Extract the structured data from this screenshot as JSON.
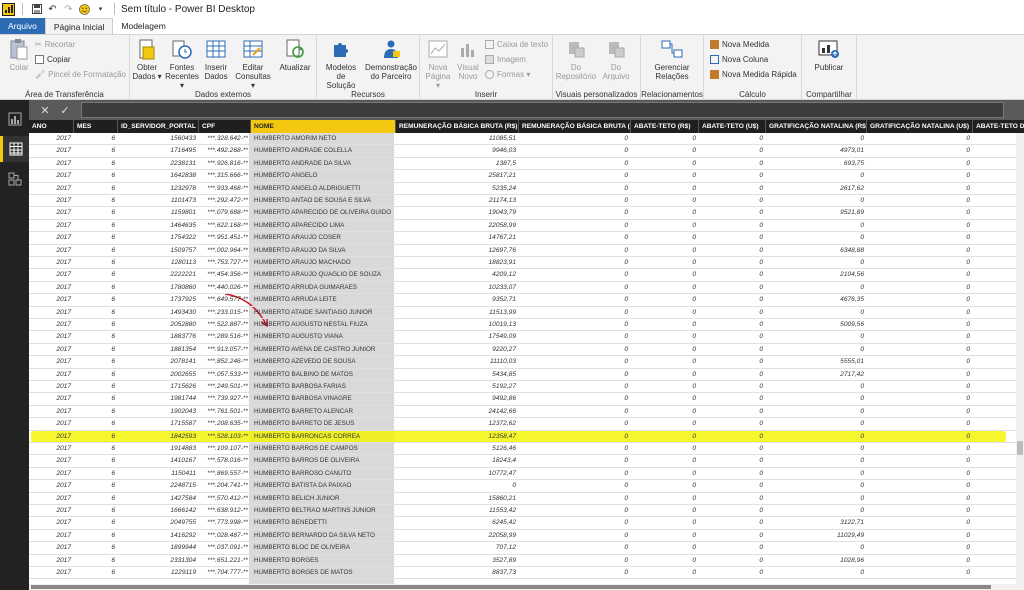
{
  "title": "Sem título - Power BI Desktop",
  "tabs": [
    "Arquivo",
    "Página Inicial",
    "Modelagem"
  ],
  "ribbon": {
    "clipboard": {
      "paste": "Colar",
      "cut": "Recortar",
      "copy": "Copiar",
      "format_painter": "Pincel de Formatação",
      "label": "Área de Transferência"
    },
    "external": {
      "get_data": "Obter Dados ▾",
      "recent": "Fontes Recentes ▾",
      "enter_data": "Inserir Dados",
      "edit": "Editar Consultas ▾",
      "refresh": "Atualizar",
      "label": "Dados externos"
    },
    "resources": {
      "models": "Modelos de Solução",
      "demo": "Demonstração do Parceiro",
      "label": "Recursos"
    },
    "insert": {
      "new_page": "Nova Página ▾",
      "new_visual": "Visual Novo",
      "textbox": "Caixa de texto",
      "image": "Imagem",
      "shapes": "Formas ▾",
      "label": "Inserir"
    },
    "custom_visuals": {
      "from_repo": "Do Repositório",
      "from_file": "Do Arquivo",
      "label": "Visuais personalizados"
    },
    "relationships": {
      "manage": "Gerenciar Relações",
      "label": "Relacionamentos"
    },
    "calc": {
      "new_measure": "Nova Medida",
      "new_column": "Nova Coluna",
      "quick_measure": "Nova Medida Rápida",
      "label": "Cálculo"
    },
    "share": {
      "publish": "Publicar",
      "label": "Compartilhar"
    }
  },
  "columns": [
    "ANO",
    "MES",
    "ID_SERVIDOR_PORTAL",
    "CPF",
    "NOME",
    "REMUNERAÇÃO BÁSICA BRUTA (R$)",
    "REMUNERAÇÃO BÁSICA BRUTA (U$)",
    "ABATE-TETO (R$)",
    "ABATE-TETO (U$)",
    "GRATIFICAÇÃO NATALINA (R$)",
    "GRATIFICAÇÃO NATALINA (U$)",
    "ABATE-TETO DA G"
  ],
  "rows": [
    [
      "2017",
      "6",
      "1560433",
      "***.328.642-**",
      "HUMBERTO AMORIM NETO",
      "11085,51",
      "0",
      "0",
      "0",
      "0",
      "0"
    ],
    [
      "2017",
      "6",
      "1716495",
      "***.492.268-**",
      "HUMBERTO ANDRADE COLELLA",
      "9946,03",
      "0",
      "0",
      "0",
      "4973,01",
      "0"
    ],
    [
      "2017",
      "6",
      "2238131",
      "***.926.816-**",
      "HUMBERTO ANDRADE DA SILVA",
      "1387,5",
      "0",
      "0",
      "0",
      "693,75",
      "0"
    ],
    [
      "2017",
      "6",
      "1642838",
      "***.315.666-**",
      "HUMBERTO ANGELO",
      "25817,21",
      "0",
      "0",
      "0",
      "0",
      "0"
    ],
    [
      "2017",
      "6",
      "1232978",
      "***.933.468-**",
      "HUMBERTO ANGELO ALDRIGUETTI",
      "5235,24",
      "0",
      "0",
      "0",
      "2617,62",
      "0"
    ],
    [
      "2017",
      "6",
      "1101473",
      "***.292.472-**",
      "HUMBERTO ANTAO DE SOUSA E SILVA",
      "21174,13",
      "0",
      "0",
      "0",
      "0",
      "0"
    ],
    [
      "2017",
      "6",
      "1159801",
      "***.079.688-**",
      "HUMBERTO APARECIDO DE OLIVEIRA GUIDO",
      "19043,79",
      "0",
      "0",
      "0",
      "9521,89",
      "0"
    ],
    [
      "2017",
      "6",
      "1464635",
      "***.622.168-**",
      "HUMBERTO APARECIDO LIMA",
      "22058,99",
      "0",
      "0",
      "0",
      "0",
      "0"
    ],
    [
      "2017",
      "6",
      "1754322",
      "***.951.451-**",
      "HUMBERTO ARAUJO COSER",
      "14767,21",
      "0",
      "0",
      "0",
      "0",
      "0"
    ],
    [
      "2017",
      "6",
      "1509757",
      "***.002.964-**",
      "HUMBERTO ARAUJO DA SILVA",
      "12697,76",
      "0",
      "0",
      "0",
      "6348,88",
      "0"
    ],
    [
      "2017",
      "6",
      "1280113",
      "***.753.727-**",
      "HUMBERTO ARAUJO MACHADO",
      "18823,91",
      "0",
      "0",
      "0",
      "0",
      "0"
    ],
    [
      "2017",
      "6",
      "2222221",
      "***.454.356-**",
      "HUMBERTO ARAUJO QUAGLIO DE SOUZA",
      "4209,12",
      "0",
      "0",
      "0",
      "2104,56",
      "0"
    ],
    [
      "2017",
      "6",
      "1780860",
      "***.440.026-**",
      "HUMBERTO ARRUDA GUIMARAES",
      "10233,07",
      "0",
      "0",
      "0",
      "0",
      "0"
    ],
    [
      "2017",
      "6",
      "1737925",
      "***.649.577-**",
      "HUMBERTO ARRUDA LEITE",
      "9352,71",
      "0",
      "0",
      "0",
      "4676,35",
      "0"
    ],
    [
      "2017",
      "6",
      "1493430",
      "***.233.015-**",
      "HUMBERTO ATAIDE SANTIAGO JUNIOR",
      "11513,99",
      "0",
      "0",
      "0",
      "0",
      "0"
    ],
    [
      "2017",
      "6",
      "2052880",
      "***.522.887-**",
      "HUMBERTO AUGUSTO NESTAL FIUZA",
      "10019,13",
      "0",
      "0",
      "0",
      "5009,56",
      "0"
    ],
    [
      "2017",
      "6",
      "1883776",
      "***.289.516-**",
      "HUMBERTO AUGUSTO VIANA",
      "17549,09",
      "0",
      "0",
      "0",
      "0",
      "0"
    ],
    [
      "2017",
      "6",
      "1881354",
      "***.913.057-**",
      "HUMBERTO AVENA DE CASTRO JUNIOR",
      "9220,27",
      "0",
      "0",
      "0",
      "0",
      "0"
    ],
    [
      "2017",
      "6",
      "2078141",
      "***.852.246-**",
      "HUMBERTO AZEVEDO DE SOUSA",
      "11110,03",
      "0",
      "0",
      "0",
      "5555,01",
      "0"
    ],
    [
      "2017",
      "6",
      "2002655",
      "***.057.533-**",
      "HUMBERTO BALBINO DE MATOS",
      "5434,85",
      "0",
      "0",
      "0",
      "2717,42",
      "0"
    ],
    [
      "2017",
      "6",
      "1715626",
      "***.249.501-**",
      "HUMBERTO BARBOSA FARIAS",
      "5192,27",
      "0",
      "0",
      "0",
      "0",
      "0"
    ],
    [
      "2017",
      "6",
      "1981744",
      "***.739.927-**",
      "HUMBERTO BARBOSA VINAGRE",
      "9492,86",
      "0",
      "0",
      "0",
      "0",
      "0"
    ],
    [
      "2017",
      "6",
      "1902043",
      "***.761.501-**",
      "HUMBERTO BARRETO ALENCAR",
      "24142,66",
      "0",
      "0",
      "0",
      "0",
      "0"
    ],
    [
      "2017",
      "6",
      "1715587",
      "***.208.635-**",
      "HUMBERTO BARRETO DE JESUS",
      "12372,62",
      "0",
      "0",
      "0",
      "0",
      "0"
    ],
    [
      "2017",
      "6",
      "1842593",
      "***.528.103-**",
      "HUMBERTO BARRONCAS CORREA",
      "12358,47",
      "0",
      "0",
      "0",
      "0",
      "0"
    ],
    [
      "2017",
      "6",
      "1914883",
      "***.109.107-**",
      "HUMBERTO BARROS DE CAMPOS",
      "5126,46",
      "0",
      "0",
      "0",
      "0",
      "0"
    ],
    [
      "2017",
      "6",
      "1410167",
      "***.578.016-**",
      "HUMBERTO BARROS DE OLIVEIRA",
      "18243,4",
      "0",
      "0",
      "0",
      "0",
      "0"
    ],
    [
      "2017",
      "6",
      "1150411",
      "***.869.557-**",
      "HUMBERTO BARROSO CANUTO",
      "10772,47",
      "0",
      "0",
      "0",
      "0",
      "0"
    ],
    [
      "2017",
      "6",
      "2248715",
      "***.204.741-**",
      "HUMBERTO BATISTA DA PAIXAO",
      "0",
      "0",
      "0",
      "0",
      "0",
      "0"
    ],
    [
      "2017",
      "6",
      "1427584",
      "***.570.412-**",
      "HUMBERTO BELICH JUNIOR",
      "15860,21",
      "0",
      "0",
      "0",
      "0",
      "0"
    ],
    [
      "2017",
      "6",
      "1666142",
      "***.638.912-**",
      "HUMBERTO BELTRAO MARTINS JUNIOR",
      "11553,42",
      "0",
      "0",
      "0",
      "0",
      "0"
    ],
    [
      "2017",
      "6",
      "2049755",
      "***.773.998-**",
      "HUMBERTO BENEDETTI",
      "6245,42",
      "0",
      "0",
      "0",
      "3122,71",
      "0"
    ],
    [
      "2017",
      "6",
      "1416292",
      "***.028.487-**",
      "HUMBERTO BERNARDO DA SILVA NETO",
      "22058,99",
      "0",
      "0",
      "0",
      "11029,49",
      "0"
    ],
    [
      "2017",
      "6",
      "1899944",
      "***.037.091-**",
      "HUMBERTO BLOC DE OLIVEIRA",
      "707,12",
      "0",
      "0",
      "0",
      "0",
      "0"
    ],
    [
      "2017",
      "6",
      "2331304",
      "***.651.221-**",
      "HUMBERTO BORGES",
      "3527,89",
      "0",
      "0",
      "0",
      "1028,96",
      "0"
    ],
    [
      "2017",
      "6",
      "1229119",
      "***.704.777-**",
      "HUMBERTO BORGES DE MATOS",
      "8837,73",
      "0",
      "0",
      "0",
      "0",
      "0"
    ]
  ],
  "highlighted_row_index": 14
}
